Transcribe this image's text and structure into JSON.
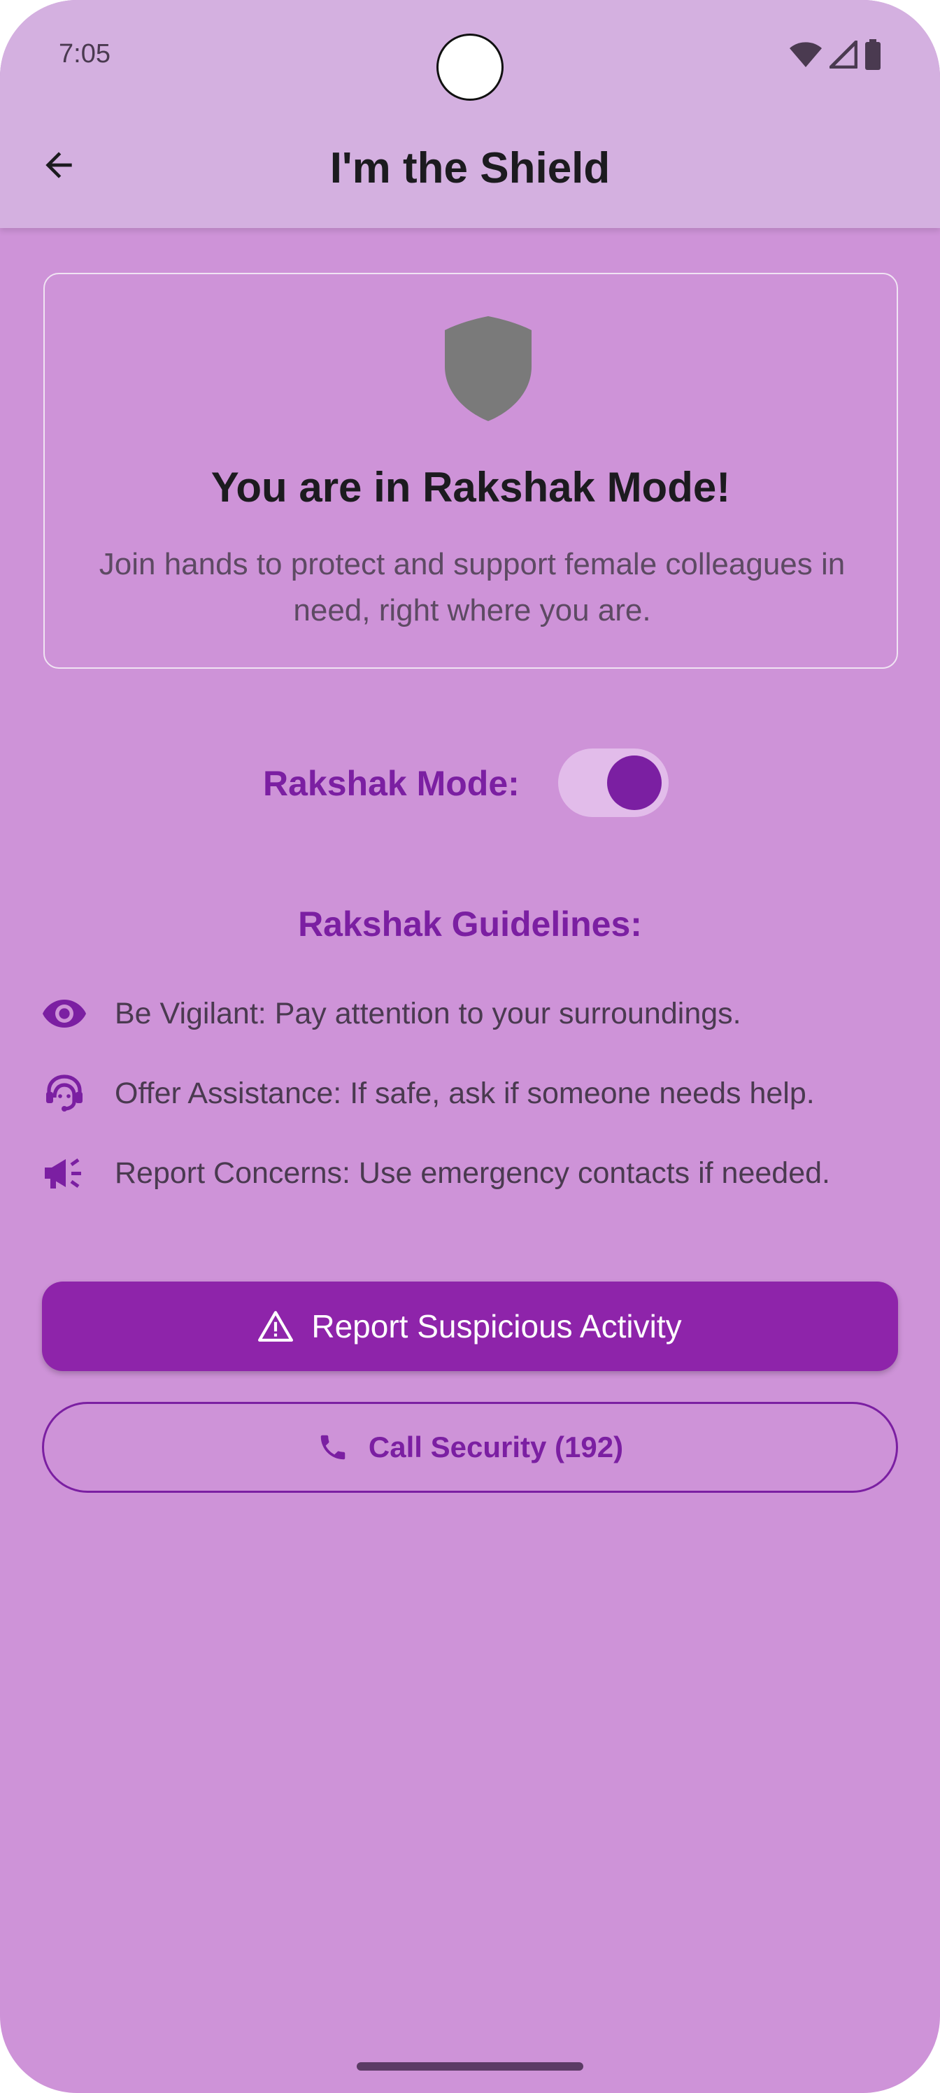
{
  "status_bar": {
    "time": "7:05",
    "icons": [
      "wifi-icon",
      "cellular-signal-icon",
      "battery-icon"
    ]
  },
  "app_bar": {
    "back_icon": "arrow-back-icon",
    "title": "I'm the Shield"
  },
  "hero_card": {
    "icon": "shield-icon",
    "title": "You are in Rakshak Mode!",
    "description": "Join hands to protect and support female colleagues in need, right where you are."
  },
  "mode_toggle": {
    "label": "Rakshak Mode:",
    "enabled": true
  },
  "guidelines": {
    "title": "Rakshak Guidelines:",
    "items": [
      {
        "icon": "eye-icon",
        "text": "Be Vigilant: Pay attention to your surroundings."
      },
      {
        "icon": "support-agent-icon",
        "text": "Offer Assistance: If safe, ask if someone needs help."
      },
      {
        "icon": "campaign-megaphone-icon",
        "text": "Report Concerns: Use emergency contacts if needed."
      }
    ]
  },
  "actions": {
    "report_label": "Report Suspicious Activity",
    "report_icon": "warning-triangle-icon",
    "call_label": "Call Security (192)",
    "call_icon": "phone-icon"
  },
  "colors": {
    "background": "#ce93d8",
    "app_bar": "#d4b0e0",
    "accent": "#7b1fa2",
    "primary_button": "#8e24aa"
  }
}
